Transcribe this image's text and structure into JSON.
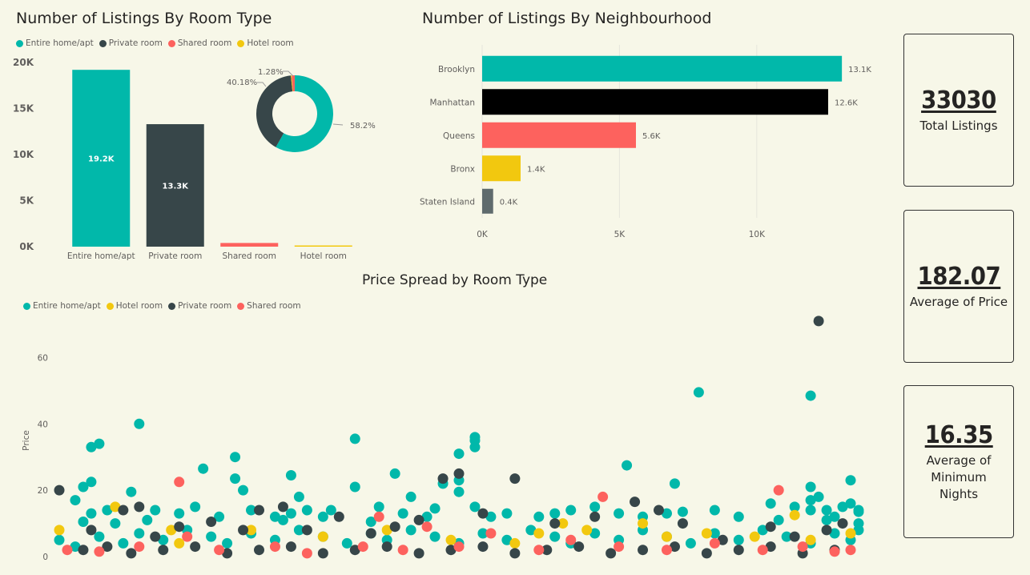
{
  "colors": {
    "entire": "#01b8aa",
    "private": "#374649",
    "shared": "#fd625e",
    "hotel": "#f2c80f",
    "manhattan": "#000000",
    "staten": "#5f6b6d"
  },
  "chart_data": [
    {
      "id": "room-type",
      "type": "bar",
      "title": "Number of Listings By Room Type",
      "categories": [
        "Entire home/apt",
        "Private room",
        "Shared room",
        "Hotel room"
      ],
      "values": [
        19200,
        13300,
        400,
        130
      ],
      "data_labels": [
        "19.2K",
        "13.3K",
        "",
        ""
      ],
      "ylim": [
        0,
        20000
      ],
      "yticks": [
        0,
        5000,
        10000,
        15000,
        20000
      ],
      "ytick_labels": [
        "0K",
        "5K",
        "10K",
        "15K",
        "20K"
      ],
      "legend": [
        "Entire home/apt",
        "Private room",
        "Shared room",
        "Hotel room"
      ],
      "legend_position": "top-left"
    },
    {
      "id": "room-type-donut",
      "type": "pie",
      "categories": [
        "Entire home/apt",
        "Private room",
        "Hotel room",
        "Shared room"
      ],
      "values": [
        58.2,
        40.18,
        0.34,
        1.28
      ],
      "data_labels": [
        "58.2%",
        "40.18%",
        "",
        "1.28%"
      ]
    },
    {
      "id": "neighbourhood",
      "type": "bar",
      "orientation": "horizontal",
      "title": "Number of Listings By Neighbourhood",
      "categories": [
        "Brooklyn",
        "Manhattan",
        "Queens",
        "Bronx",
        "Staten Island"
      ],
      "values": [
        13100,
        12600,
        5600,
        1400,
        400
      ],
      "data_labels": [
        "13.1K",
        "12.6K",
        "5.6K",
        "1.4K",
        "0.4K"
      ],
      "xlim": [
        0,
        14000
      ],
      "xticks": [
        0,
        5000,
        10000
      ],
      "xtick_labels": [
        "0K",
        "5K",
        "10K"
      ],
      "grid": true
    },
    {
      "id": "price-spread",
      "type": "scatter",
      "title": "Price Spread by Room Type",
      "ylabel": "Price",
      "ylim": [
        0,
        70
      ],
      "yticks": [
        0,
        20,
        40,
        60
      ],
      "legend": [
        "Entire home/apt",
        "Hotel room",
        "Private room",
        "Shared room"
      ],
      "legend_position": "top-left",
      "series": [
        {
          "name": "Entire home/apt",
          "points": [
            [
              0.02,
              17
            ],
            [
              0.03,
              10.5
            ],
            [
              0.04,
              13
            ],
            [
              0.03,
              21
            ],
            [
              0.04,
              22.5
            ],
            [
              0.04,
              33
            ],
            [
              0.05,
              34
            ],
            [
              0.06,
              14
            ],
            [
              0.07,
              10
            ],
            [
              0.09,
              19.5
            ],
            [
              0.1,
              40
            ],
            [
              0.11,
              11
            ],
            [
              0.12,
              14
            ],
            [
              0.15,
              13
            ],
            [
              0.17,
              15
            ],
            [
              0.18,
              26.5
            ],
            [
              0.2,
              12
            ],
            [
              0.22,
              30
            ],
            [
              0.22,
              23.5
            ],
            [
              0.23,
              20
            ],
            [
              0.24,
              14
            ],
            [
              0.27,
              12
            ],
            [
              0.28,
              11
            ],
            [
              0.29,
              13
            ],
            [
              0.29,
              24.5
            ],
            [
              0.3,
              18
            ],
            [
              0.31,
              14
            ],
            [
              0.33,
              12
            ],
            [
              0.34,
              14
            ],
            [
              0.37,
              21
            ],
            [
              0.37,
              35.5
            ],
            [
              0.39,
              10.5
            ],
            [
              0.4,
              15
            ],
            [
              0.42,
              25
            ],
            [
              0.43,
              13
            ],
            [
              0.44,
              18
            ],
            [
              0.46,
              12
            ],
            [
              0.47,
              14.5
            ],
            [
              0.48,
              22
            ],
            [
              0.5,
              19.5
            ],
            [
              0.5,
              23
            ],
            [
              0.5,
              31
            ],
            [
              0.52,
              33
            ],
            [
              0.52,
              36
            ],
            [
              0.52,
              35
            ],
            [
              0.52,
              15
            ],
            [
              0.54,
              12
            ],
            [
              0.56,
              13
            ],
            [
              0.6,
              12
            ],
            [
              0.62,
              13
            ],
            [
              0.64,
              14
            ],
            [
              0.67,
              15
            ],
            [
              0.7,
              13
            ],
            [
              0.71,
              27.5
            ],
            [
              0.73,
              12
            ],
            [
              0.76,
              13
            ],
            [
              0.77,
              22
            ],
            [
              0.78,
              13.5
            ],
            [
              0.8,
              49.5
            ],
            [
              0.82,
              14
            ],
            [
              0.85,
              12
            ],
            [
              0.89,
              16
            ],
            [
              0.9,
              11
            ],
            [
              0.92,
              15
            ],
            [
              0.94,
              14
            ],
            [
              0.94,
              48.5
            ],
            [
              0.94,
              17
            ],
            [
              0.94,
              21
            ],
            [
              0.95,
              18
            ],
            [
              0.96,
              11
            ],
            [
              0.96,
              14
            ],
            [
              0.97,
              12
            ],
            [
              0.98,
              15
            ],
            [
              0.99,
              23
            ],
            [
              1.0,
              10
            ],
            [
              1.0,
              14
            ],
            [
              0.99,
              16
            ],
            [
              1.0,
              13.5
            ],
            [
              1.0,
              8
            ],
            [
              0.0,
              5
            ],
            [
              0.02,
              3
            ],
            [
              0.05,
              6
            ],
            [
              0.08,
              4
            ],
            [
              0.1,
              7
            ],
            [
              0.13,
              5
            ],
            [
              0.16,
              8
            ],
            [
              0.19,
              6
            ],
            [
              0.21,
              4
            ],
            [
              0.24,
              7
            ],
            [
              0.27,
              5
            ],
            [
              0.3,
              8
            ],
            [
              0.33,
              6
            ],
            [
              0.36,
              4
            ],
            [
              0.39,
              7
            ],
            [
              0.41,
              5
            ],
            [
              0.44,
              8
            ],
            [
              0.47,
              6
            ],
            [
              0.5,
              4
            ],
            [
              0.53,
              7
            ],
            [
              0.56,
              5
            ],
            [
              0.59,
              8
            ],
            [
              0.62,
              6
            ],
            [
              0.64,
              4
            ],
            [
              0.67,
              7
            ],
            [
              0.7,
              5
            ],
            [
              0.73,
              8
            ],
            [
              0.76,
              6
            ],
            [
              0.79,
              4
            ],
            [
              0.82,
              7
            ],
            [
              0.85,
              5
            ],
            [
              0.88,
              8
            ],
            [
              0.91,
              6
            ],
            [
              0.94,
              4
            ],
            [
              0.97,
              7
            ],
            [
              0.99,
              5
            ]
          ]
        },
        {
          "name": "Hotel room",
          "points": [
            [
              0.0,
              8
            ],
            [
              0.07,
              15
            ],
            [
              0.14,
              8
            ],
            [
              0.15,
              4
            ],
            [
              0.24,
              8
            ],
            [
              0.33,
              6
            ],
            [
              0.41,
              8
            ],
            [
              0.49,
              5
            ],
            [
              0.57,
              4
            ],
            [
              0.6,
              7
            ],
            [
              0.63,
              10
            ],
            [
              0.66,
              8
            ],
            [
              0.73,
              10
            ],
            [
              0.76,
              6
            ],
            [
              0.81,
              7
            ],
            [
              0.87,
              6
            ],
            [
              0.94,
              5
            ],
            [
              0.99,
              7
            ],
            [
              0.92,
              12.5
            ]
          ]
        },
        {
          "name": "Private room",
          "points": [
            [
              0.0,
              20
            ],
            [
              0.04,
              8
            ],
            [
              0.08,
              14
            ],
            [
              0.1,
              15
            ],
            [
              0.12,
              6
            ],
            [
              0.15,
              9
            ],
            [
              0.19,
              10.5
            ],
            [
              0.23,
              8
            ],
            [
              0.25,
              14
            ],
            [
              0.28,
              15
            ],
            [
              0.31,
              8
            ],
            [
              0.35,
              12
            ],
            [
              0.39,
              7
            ],
            [
              0.42,
              9
            ],
            [
              0.45,
              11
            ],
            [
              0.48,
              23.5
            ],
            [
              0.5,
              25
            ],
            [
              0.53,
              13
            ],
            [
              0.57,
              23.5
            ],
            [
              0.62,
              10
            ],
            [
              0.67,
              12
            ],
            [
              0.72,
              16.5
            ],
            [
              0.75,
              14
            ],
            [
              0.78,
              10
            ],
            [
              0.83,
              5
            ],
            [
              0.89,
              9
            ],
            [
              0.92,
              6
            ],
            [
              0.96,
              8
            ],
            [
              0.98,
              10
            ],
            [
              0.95,
              71
            ],
            [
              0.03,
              2
            ],
            [
              0.06,
              3
            ],
            [
              0.09,
              1
            ],
            [
              0.13,
              2
            ],
            [
              0.17,
              3
            ],
            [
              0.21,
              1
            ],
            [
              0.25,
              2
            ],
            [
              0.29,
              3
            ],
            [
              0.33,
              1
            ],
            [
              0.37,
              2
            ],
            [
              0.41,
              3
            ],
            [
              0.45,
              1
            ],
            [
              0.49,
              2
            ],
            [
              0.53,
              3
            ],
            [
              0.57,
              1
            ],
            [
              0.61,
              2
            ],
            [
              0.65,
              3
            ],
            [
              0.69,
              1
            ],
            [
              0.73,
              2
            ],
            [
              0.77,
              3
            ],
            [
              0.81,
              1
            ],
            [
              0.85,
              2
            ],
            [
              0.89,
              3
            ],
            [
              0.93,
              1
            ],
            [
              0.97,
              2
            ]
          ]
        },
        {
          "name": "Shared room",
          "points": [
            [
              0.01,
              2
            ],
            [
              0.05,
              1.5
            ],
            [
              0.1,
              3
            ],
            [
              0.15,
              22.5
            ],
            [
              0.16,
              6
            ],
            [
              0.2,
              2
            ],
            [
              0.27,
              3
            ],
            [
              0.31,
              1
            ],
            [
              0.38,
              3
            ],
            [
              0.4,
              12
            ],
            [
              0.43,
              2
            ],
            [
              0.46,
              9
            ],
            [
              0.5,
              3
            ],
            [
              0.54,
              7
            ],
            [
              0.6,
              2
            ],
            [
              0.64,
              5
            ],
            [
              0.68,
              18
            ],
            [
              0.7,
              3
            ],
            [
              0.76,
              2
            ],
            [
              0.82,
              4
            ],
            [
              0.88,
              2
            ],
            [
              0.9,
              20
            ],
            [
              0.93,
              3
            ],
            [
              0.97,
              1.5
            ],
            [
              0.99,
              2
            ]
          ]
        }
      ]
    }
  ],
  "kpis": [
    {
      "value": "33030",
      "label": "Total Listings"
    },
    {
      "value": "182.07",
      "label": "Average of Price"
    },
    {
      "value": "16.35",
      "label": "Average of Minimum Nights"
    }
  ]
}
